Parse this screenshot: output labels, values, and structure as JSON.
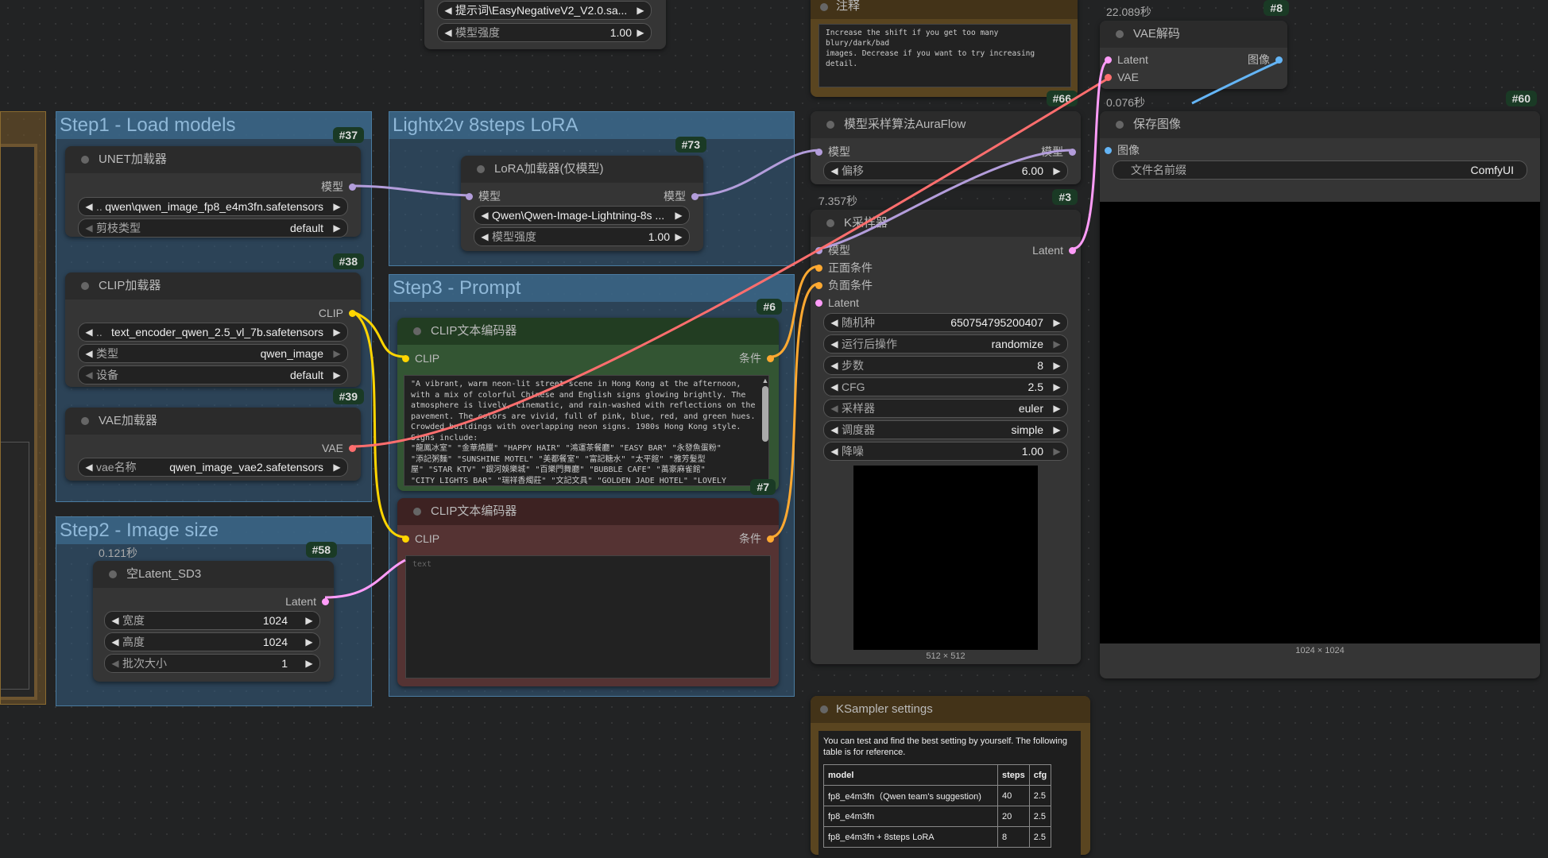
{
  "top_fragment": {
    "lora_name": "提示词\\EasyNegativeV2_V2.0.sa...",
    "strength_label": "模型强度",
    "strength_value": "1.00"
  },
  "groups": {
    "step1": "Step1 - Load models",
    "lightx": "Lightx2v 8steps LoRA",
    "step3": "Step3 - Prompt",
    "step2": "Step2 - Image size"
  },
  "unet": {
    "badge": "#37",
    "title": "UNET加载器",
    "out": "模型",
    "file": "qwen\\qwen_image_fp8_e4m3fn.safetensors",
    "file_prefix": "..",
    "dtype_label": "剪枝类型",
    "dtype_value": "default"
  },
  "clip_loader": {
    "badge": "#38",
    "title": "CLIP加载器",
    "out": "CLIP",
    "file_prefix": "..",
    "file": "text_encoder_qwen_2.5_vl_7b.safetensors",
    "type_label": "类型",
    "type_value": "qwen_image",
    "device_label": "设备",
    "device_value": "default"
  },
  "vae_loader": {
    "badge": "#39",
    "title": "VAE加载器",
    "out": "VAE",
    "name_label": "vae名称",
    "name_value": "qwen_image_vae2.safetensors"
  },
  "lora": {
    "badge": "#73",
    "title": "LoRA加载器(仅模型)",
    "in": "模型",
    "out": "模型",
    "file": "Qwen\\Qwen-Image-Lightning-8s ...",
    "strength_label": "模型强度",
    "strength_value": "1.00"
  },
  "clip_pos": {
    "badge": "#6",
    "title": "CLIP文本编码器",
    "in": "CLIP",
    "out": "条件",
    "text": "\"A vibrant, warm neon-lit street scene in Hong Kong at the afternoon,\nwith a mix of colorful Chinese and English signs glowing brightly. The\natmosphere is lively, cinematic, and rain-washed with reflections on the\npavement. The colors are vivid, full of pink, blue, red, and green hues.\nCrowded buildings with overlapping neon signs. 1980s Hong Kong style.\nSigns include:\n\"龍鳳冰室\" \"金華燒臘\" \"HAPPY HAIR\" \"鴻運茶餐廳\" \"EASY BAR\" \"永發魚蛋粉\"\n\"添記粥麵\" \"SUNSHINE MOTEL\" \"美都餐室\" \"富記糖水\" \"太平館\" \"雅芳髮型\n屋\" \"STAR KTV\" \"銀河娛樂城\" \"百樂門舞廳\" \"BUBBLE CAFE\" \"萬豪麻雀館\"\n\"CITY LIGHTS BAR\" \"瑞祥香燭莊\" \"文記文具\" \"GOLDEN JADE HOTEL\" \"LOVELY"
  },
  "clip_neg": {
    "badge": "#7",
    "title": "CLIP文本编码器",
    "in": "CLIP",
    "out": "条件",
    "placeholder": "text"
  },
  "latent": {
    "badge": "#58",
    "timer": "0.121秒",
    "title": "空Latent_SD3",
    "out": "Latent",
    "width_label": "宽度",
    "width_value": "1024",
    "height_label": "高度",
    "height_value": "1024",
    "batch_label": "批次大小",
    "batch_value": "1"
  },
  "note": {
    "title": "注释",
    "text": "Increase the shift if you get too many blury/dark/bad\nimages. Decrease if you want to try increasing\ndetail."
  },
  "auraflow": {
    "badge": "#66",
    "title": "模型采样算法AuraFlow",
    "in": "模型",
    "out": "模型",
    "shift_label": "偏移",
    "shift_value": "6.00"
  },
  "ksampler": {
    "badge": "#3",
    "timer": "7.357秒",
    "title": "K采样器",
    "in_model": "模型",
    "in_pos": "正面条件",
    "in_neg": "负面条件",
    "in_latent": "Latent",
    "out": "Latent",
    "widgets": [
      {
        "label": "随机种",
        "value": "650754795200407"
      },
      {
        "label": "运行后操作",
        "value": "randomize"
      },
      {
        "label": "步数",
        "value": "8"
      },
      {
        "label": "CFG",
        "value": "2.5"
      },
      {
        "label": "采样器",
        "value": "euler"
      },
      {
        "label": "调度器",
        "value": "simple"
      },
      {
        "label": "降噪",
        "value": "1.00"
      }
    ],
    "preview_size": "512 × 512"
  },
  "vae_decode": {
    "badge": "#8",
    "timer": "22.089秒",
    "title": "VAE解码",
    "in_latent": "Latent",
    "in_vae": "VAE",
    "out": "图像"
  },
  "save_image": {
    "badge": "#60",
    "timer": "0.076秒",
    "title": "保存图像",
    "in": "图像",
    "prefix_label": "文件名前缀",
    "prefix_value": "ComfyUI",
    "preview_size": "1024 × 1024"
  },
  "ks_settings": {
    "title": "KSampler settings",
    "intro": "You can test and find the best setting by yourself. The following table is for reference.",
    "headers": [
      "model",
      "steps",
      "cfg"
    ],
    "rows": [
      [
        "fp8_e4m3fn（Qwen team's suggestion)",
        "40",
        "2.5"
      ],
      [
        "fp8_e4m3fn",
        "20",
        "2.5"
      ],
      [
        "fp8_e4m3fn + 8steps LoRA",
        "8",
        "2.5"
      ]
    ]
  },
  "colors": {
    "model": "#b39ddb",
    "clip": "#ffd500",
    "vae": "#ff6e6e",
    "latent": "#ff9cf9",
    "conditioning": "#ffa931",
    "image": "#64b5f6"
  }
}
